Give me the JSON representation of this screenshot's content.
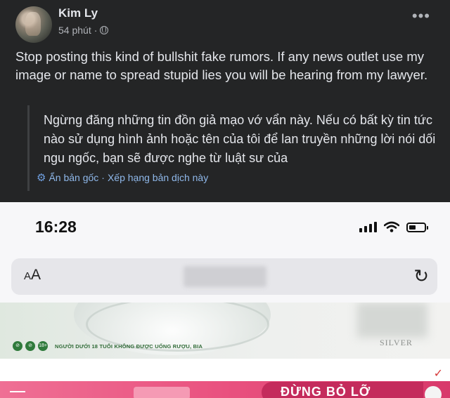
{
  "post": {
    "author": "Kim Ly",
    "time": "54 phút",
    "separator": "·",
    "more": "•••",
    "text": "Stop posting this kind of bullshit fake rumors. If any news outlet use my image or name to spread stupid lies you will be hearing from my lawyer.",
    "translation": "Ngừng đăng những tin đồn giả mạo vớ vẩn này. Nếu có bất kỳ tin tức nào sử dụng hình ảnh hoặc tên của tôi để lan truyền những lời nói dối ngu ngốc, bạn sẽ được nghe từ luật sư của",
    "hide_original": "Ẩn bản gốc",
    "rate_translation": "Xếp hạng bản dịch này",
    "gear_icon": "⚙"
  },
  "phone": {
    "time": "16:28",
    "aa_label_big": "A",
    "aa_label_small": "A",
    "reload_icon": "↻",
    "banner_warning": "NGƯỜI DƯỚI 18 TUỔI KHÔNG ĐƯỢC UỐNG RƯỢU, BIA",
    "banner_badges": [
      "⊘",
      "⊘",
      "18+"
    ],
    "brand": "SILVER",
    "check_icon": "✓",
    "pink_title": "ĐỪNG BỎ LỠ"
  },
  "colors": {
    "post_bg": "#242526",
    "link": "#8fb8ea",
    "pink": "#e9517f"
  }
}
